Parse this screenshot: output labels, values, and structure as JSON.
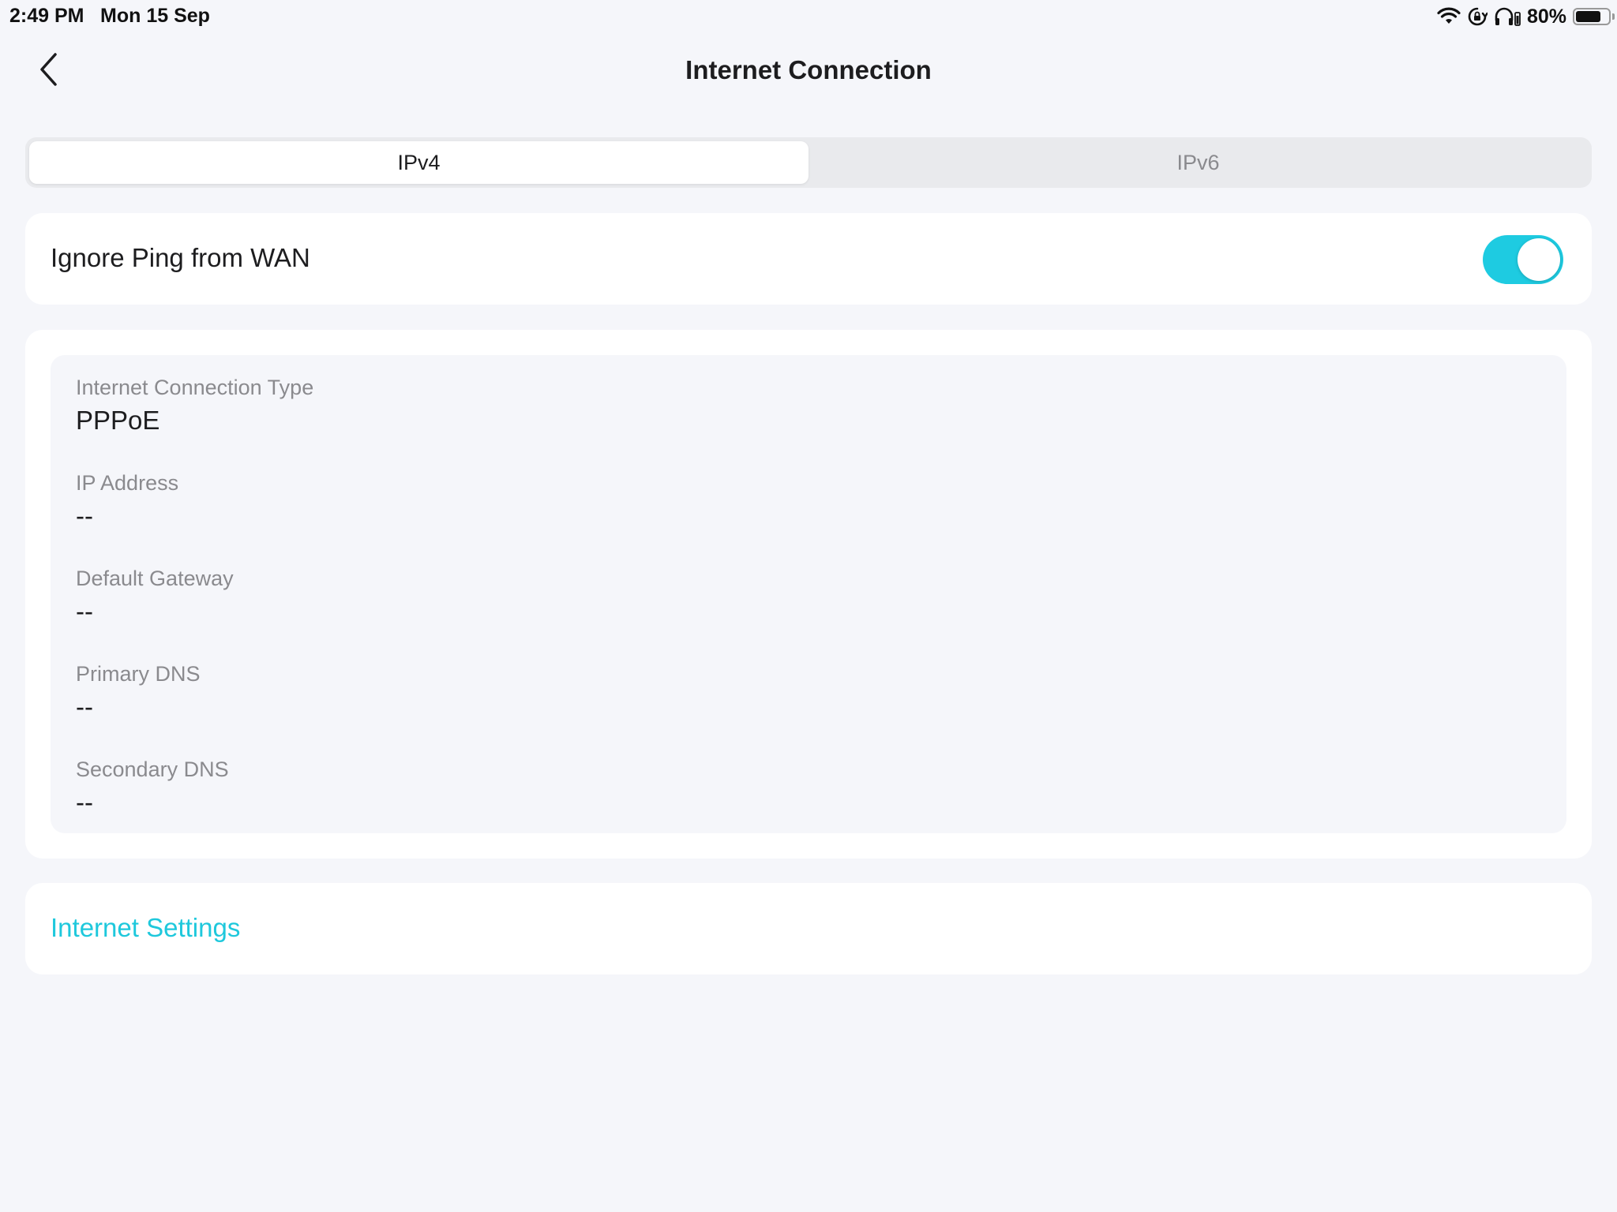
{
  "status_bar": {
    "time": "2:49 PM",
    "date": "Mon 15 Sep",
    "battery_percent": "80%",
    "battery_level": 0.8,
    "icons": [
      "wifi-icon",
      "orientation-lock-icon",
      "headphones-icon",
      "battery-icon"
    ]
  },
  "header": {
    "title": "Internet Connection",
    "back_icon": "chevron-left-icon"
  },
  "tabs": [
    {
      "label": "IPv4",
      "active": true
    },
    {
      "label": "IPv6",
      "active": false
    }
  ],
  "ping": {
    "label": "Ignore Ping from WAN",
    "enabled": true
  },
  "info": {
    "connection_type": {
      "label": "Internet Connection Type",
      "value": "PPPoE"
    },
    "ip_address": {
      "label": "IP Address",
      "value": "--"
    },
    "default_gateway": {
      "label": "Default Gateway",
      "value": "--"
    },
    "primary_dns": {
      "label": "Primary DNS",
      "value": "--"
    },
    "secondary_dns": {
      "label": "Secondary DNS",
      "value": "--"
    }
  },
  "settings": {
    "link_label": "Internet Settings"
  },
  "colors": {
    "accent": "#1ecbe1",
    "background": "#f5f6fa",
    "card": "#ffffff"
  }
}
